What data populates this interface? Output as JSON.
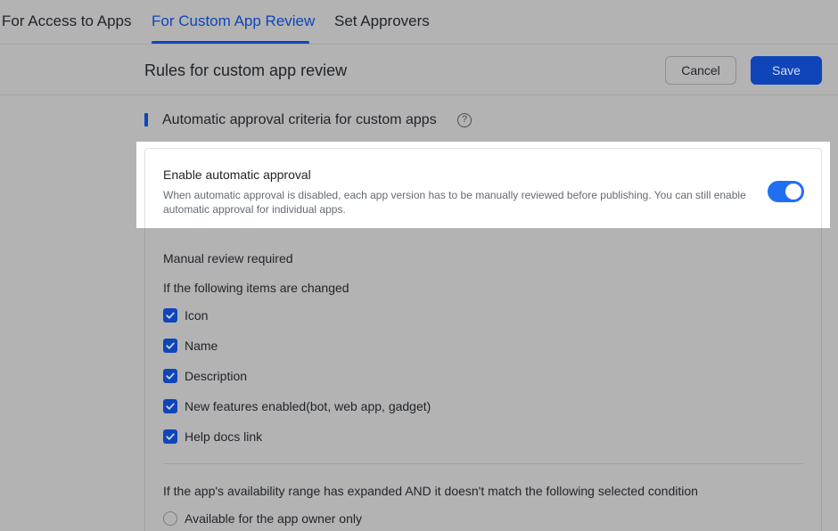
{
  "tabs": [
    {
      "label": "For Access to Apps",
      "active": false
    },
    {
      "label": "For Custom App Review",
      "active": true
    },
    {
      "label": "Set Approvers",
      "active": false
    }
  ],
  "header": {
    "title": "Rules for custom app review",
    "cancel_label": "Cancel",
    "save_label": "Save"
  },
  "section": {
    "title": "Automatic approval criteria for custom apps",
    "help_icon": "?"
  },
  "auto_approval": {
    "title": "Enable automatic approval",
    "description": "When automatic approval is disabled, each app version has to be manually reviewed before publishing. You can still enable automatic approval for individual apps.",
    "enabled": true
  },
  "manual_review": {
    "heading": "Manual review required",
    "subheading": "If the following items are changed",
    "items": [
      {
        "label": "Icon",
        "checked": true
      },
      {
        "label": "Name",
        "checked": true
      },
      {
        "label": "Description",
        "checked": true
      },
      {
        "label": "New features enabled(bot, web app, gadget)",
        "checked": true
      },
      {
        "label": "Help docs link",
        "checked": true
      }
    ]
  },
  "availability": {
    "heading": "If the app's availability range has expanded AND it doesn't match the following selected condition",
    "options": [
      {
        "label": "Available for the app owner only",
        "selected": false
      }
    ]
  },
  "colors": {
    "accent": "#0f45b8",
    "toggle_on": "#1f6ff0",
    "overlay": "#b3b3b3"
  }
}
